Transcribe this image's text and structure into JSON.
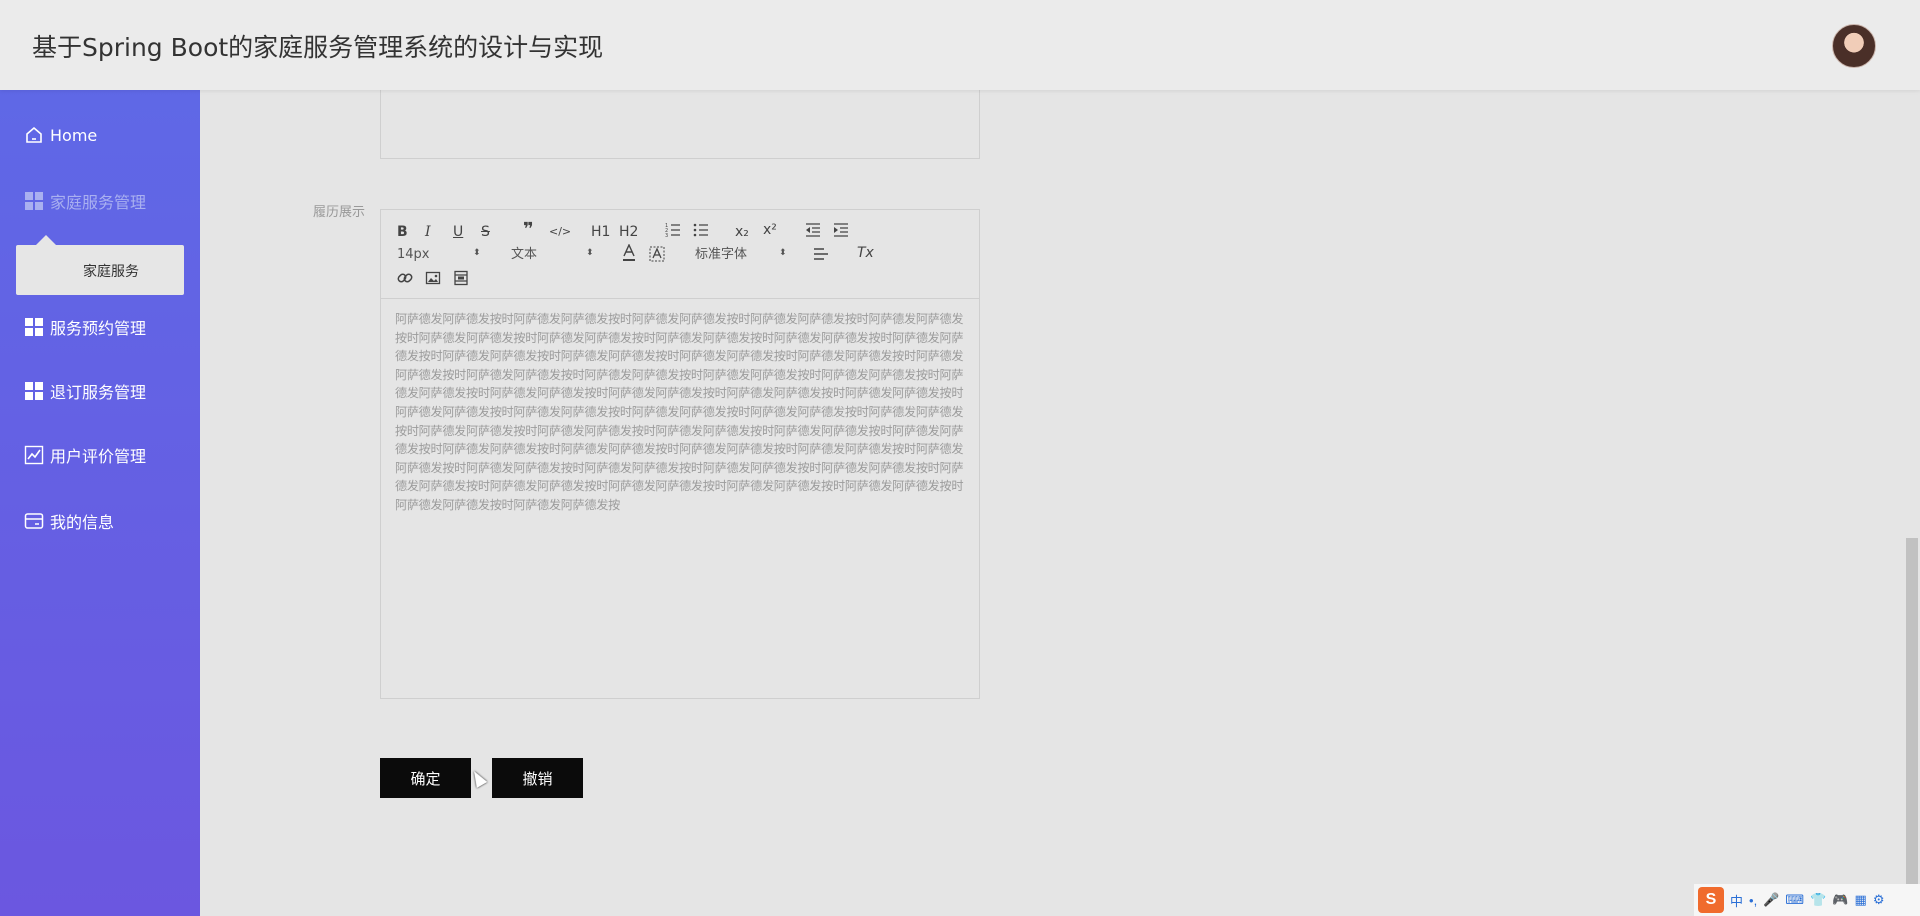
{
  "header": {
    "title": "基于Spring Boot的家庭服务管理系统的设计与实现"
  },
  "sidebar": {
    "items": [
      {
        "label": "Home",
        "icon": "home-icon"
      },
      {
        "label": "家庭服务管理",
        "icon": "grid-icon"
      },
      {
        "label": "服务预约管理",
        "icon": "grid-icon"
      },
      {
        "label": "退订服务管理",
        "icon": "grid-icon"
      },
      {
        "label": "用户评价管理",
        "icon": "chart-icon"
      },
      {
        "label": "我的信息",
        "icon": "card-icon"
      }
    ],
    "submenu": {
      "label": "家庭服务"
    }
  },
  "form": {
    "resume_label": "履历展示",
    "editor": {
      "toolbar": {
        "bold": "B",
        "italic": "I",
        "underline": "U",
        "strike": "S",
        "blockquote": "❞",
        "code": "</>",
        "h1": "H1",
        "h2": "H2",
        "subscript": "x₂",
        "superscript": "x²",
        "size_value": "14px",
        "header_value": "文本",
        "font_value": "标准字体",
        "clean": "Tx"
      },
      "content": "阿萨德发阿萨德发按时阿萨德发阿萨德发按时阿萨德发阿萨德发按时阿萨德发阿萨德发按时阿萨德发阿萨德发按时阿萨德发阿萨德发按时阿萨德发阿萨德发按时阿萨德发阿萨德发按时阿萨德发阿萨德发按时阿萨德发阿萨德发按时阿萨德发阿萨德发按时阿萨德发阿萨德发按时阿萨德发阿萨德发按时阿萨德发阿萨德发按时阿萨德发阿萨德发按时阿萨德发阿萨德发按时阿萨德发阿萨德发按时阿萨德发阿萨德发按时阿萨德发阿萨德发按时阿萨德发阿萨德发按时阿萨德发阿萨德发按时阿萨德发阿萨德发按时阿萨德发阿萨德发按时阿萨德发阿萨德发按时阿萨德发阿萨德发按时阿萨德发阿萨德发按时阿萨德发阿萨德发按时阿萨德发阿萨德发按时阿萨德发阿萨德发按时阿萨德发阿萨德发按时阿萨德发阿萨德发按时阿萨德发阿萨德发按时阿萨德发阿萨德发按时阿萨德发阿萨德发按时阿萨德发阿萨德发按时阿萨德发阿萨德发按时阿萨德发阿萨德发按时阿萨德发阿萨德发按时阿萨德发阿萨德发按时阿萨德发阿萨德发按时阿萨德发阿萨德发按时阿萨德发阿萨德发按时阿萨德发阿萨德发按时阿萨德发阿萨德发按时阿萨德发阿萨德发按时阿萨德发阿萨德发按时阿萨德发阿萨德发按时阿萨德发阿萨德发按时阿萨德发阿萨德发按时阿萨德发阿萨德发按"
    },
    "confirm_label": "确定",
    "cancel_label": "撤销"
  },
  "ime": {
    "logo": "S",
    "mode": "中"
  },
  "colors": {
    "sidebar_top": "#5f68e6",
    "sidebar_bottom": "#6b57e0",
    "button_bg": "#0b0b0b"
  }
}
